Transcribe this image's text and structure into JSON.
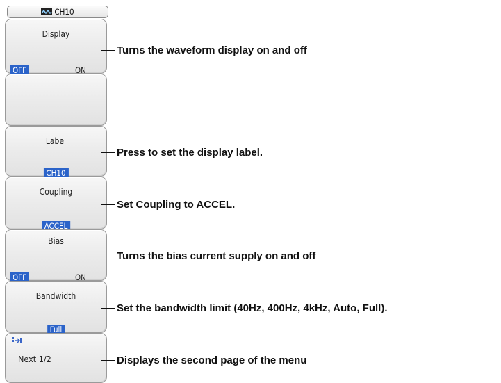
{
  "header": {
    "icon": "channel-waveform-icon",
    "title": "CH10"
  },
  "menu": {
    "display": {
      "title": "Display",
      "options": [
        "OFF",
        "ON"
      ],
      "selected": "OFF"
    },
    "blank": {},
    "label": {
      "title": "Label",
      "value": "CH10"
    },
    "coupling": {
      "title": "Coupling",
      "value": "ACCEL"
    },
    "bias": {
      "title": "Bias",
      "options": [
        "OFF",
        "ON"
      ],
      "selected": "OFF"
    },
    "bandwidth": {
      "title": "Bandwidth",
      "value": "Full"
    },
    "next": {
      "icon": "page-next-icon",
      "label": "Next 1/2"
    }
  },
  "callouts": {
    "display": "Turns the waveform display on and off",
    "label": "Press to set the display label.",
    "coupling": "Set Coupling to ACCEL.",
    "bias": "Turns the bias current supply on and off",
    "bandwidth": "Set the bandwidth limit (40Hz, 400Hz, 4kHz, Auto, Full).",
    "next": "Displays the second page of the menu"
  },
  "colors": {
    "selected_bg": "#2b63c9",
    "selected_fg": "#ffffff",
    "button_border": "#9a9a9a",
    "text": "#111111"
  }
}
